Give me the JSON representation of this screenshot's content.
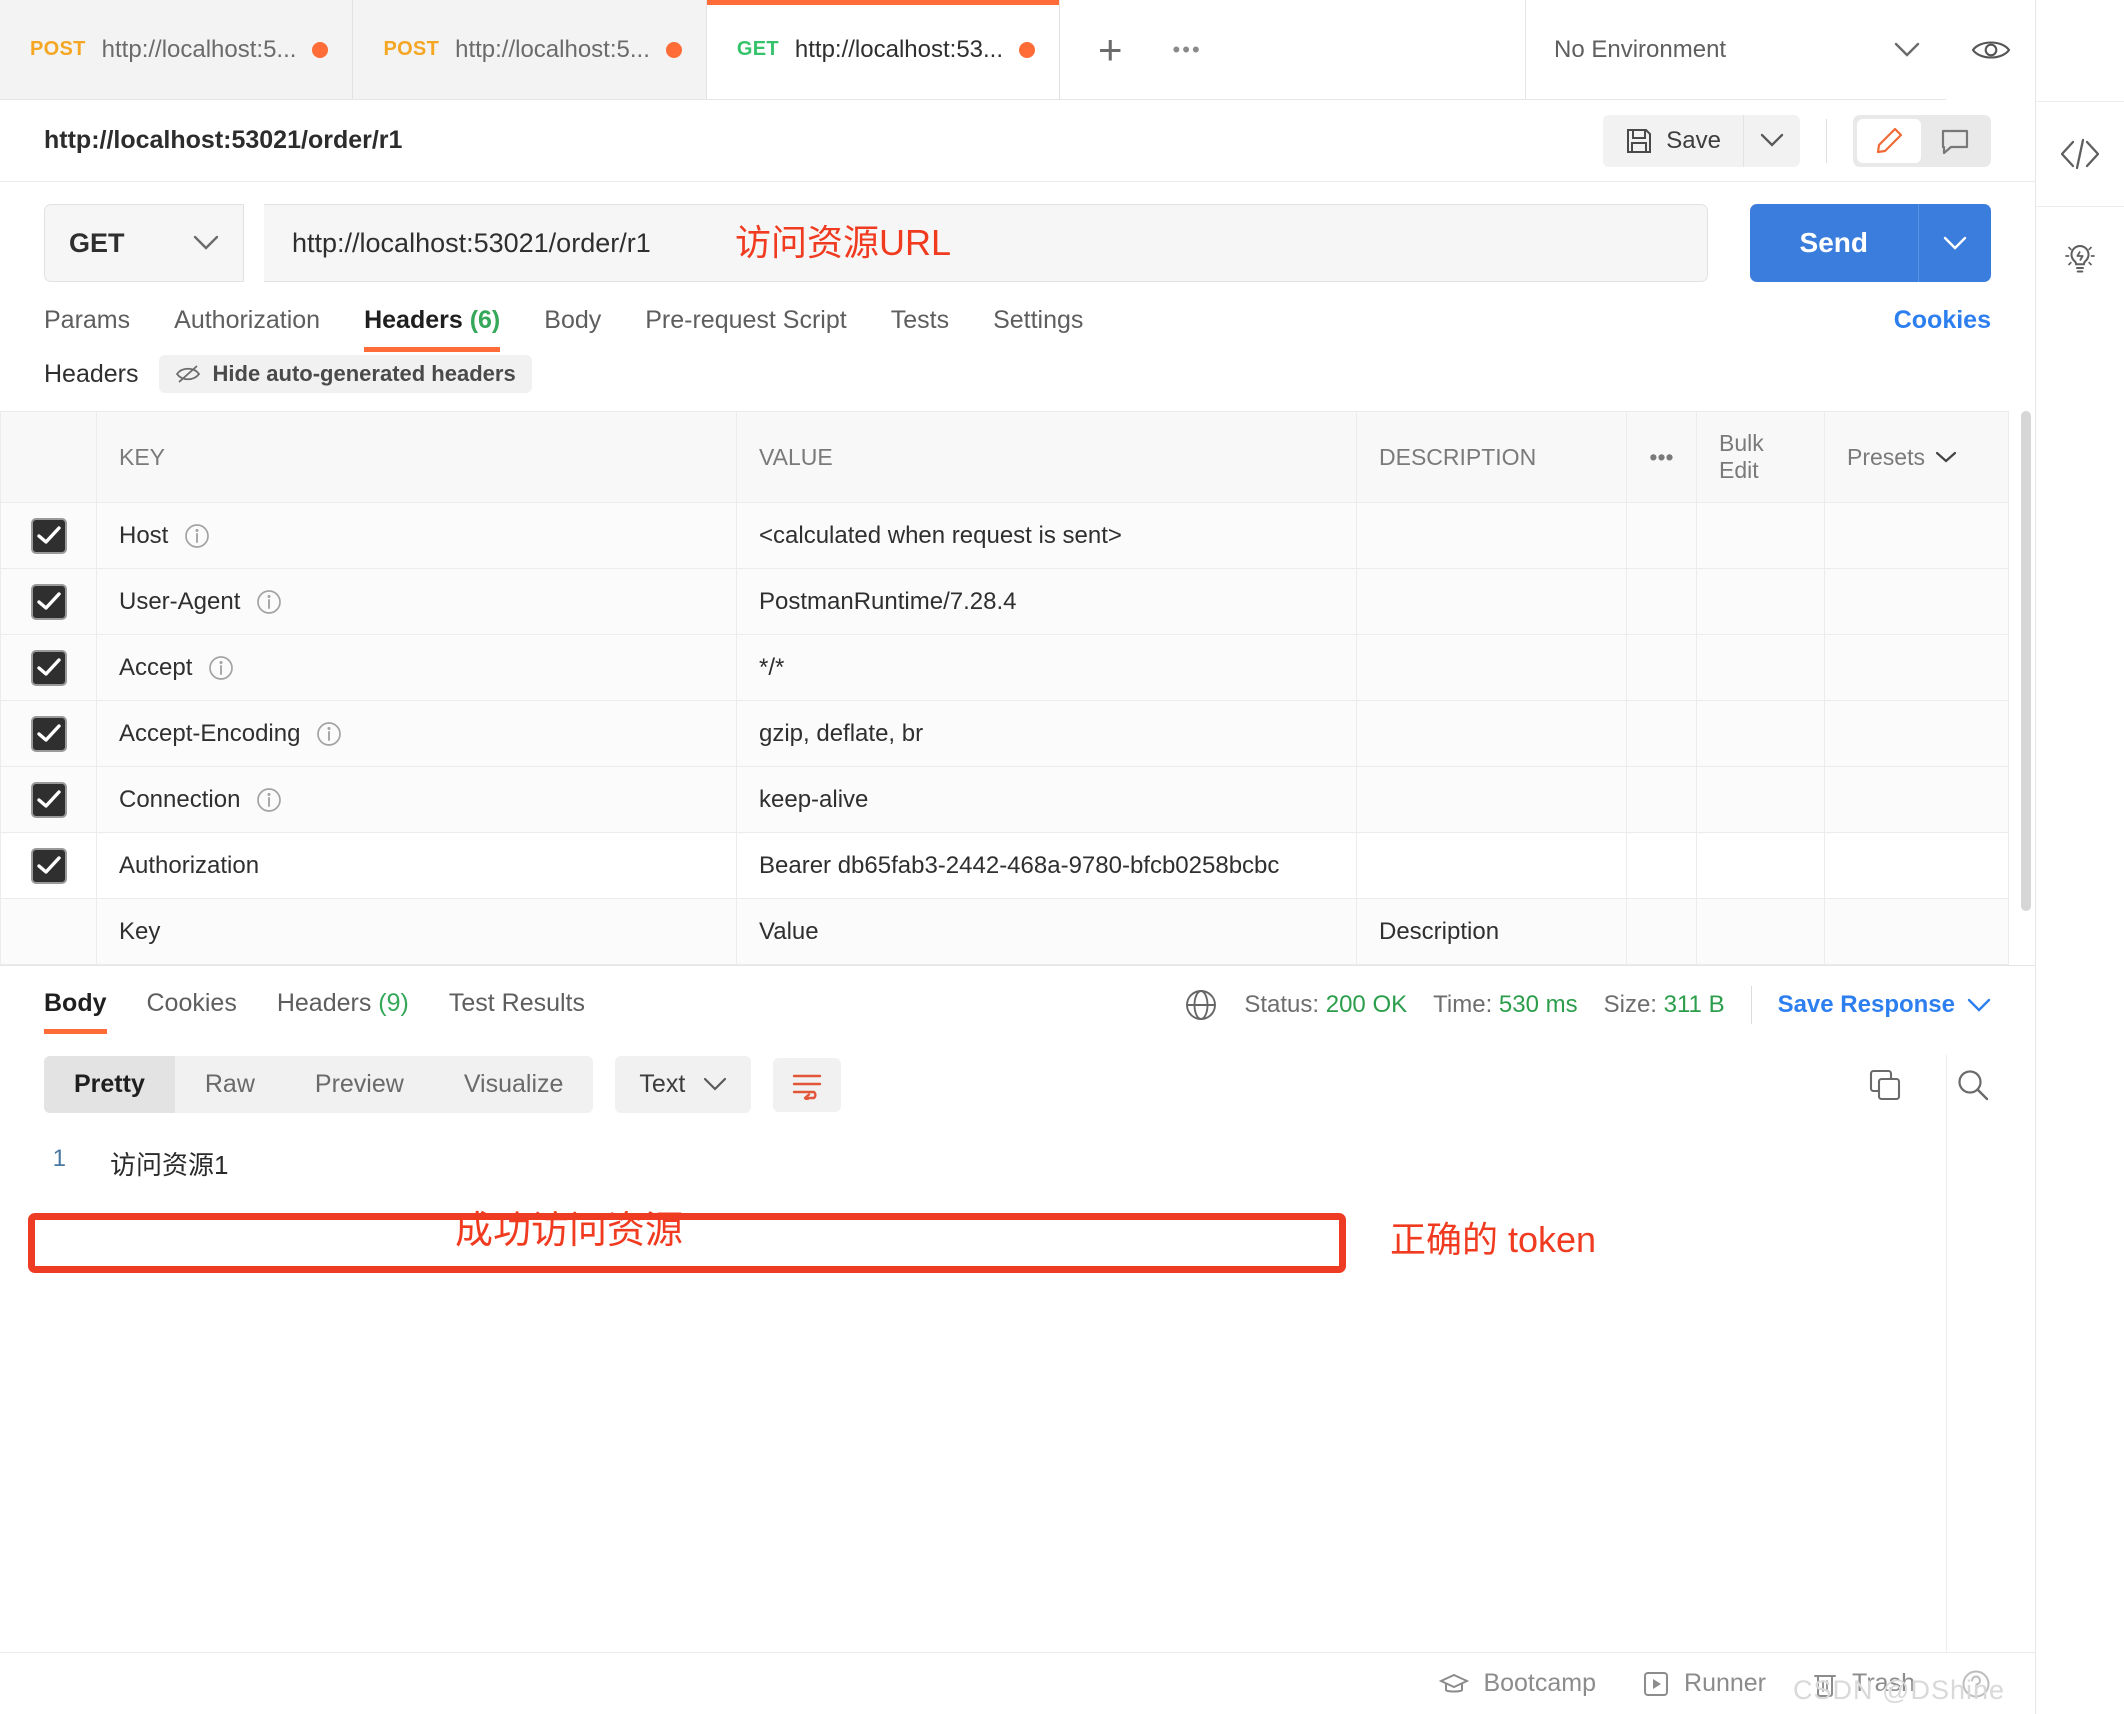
{
  "tabbar": {
    "tabs": [
      {
        "method": "POST",
        "url": "http://localhost:5...",
        "active": false
      },
      {
        "method": "POST",
        "url": "http://localhost:5...",
        "active": false
      },
      {
        "method": "GET",
        "url": "http://localhost:53...",
        "active": true
      }
    ],
    "new_tab_label": "+",
    "more_label": "•••",
    "environment": "No Environment"
  },
  "title": {
    "request_name": "http://localhost:53021/order/r1",
    "save_label": "Save"
  },
  "urlbar": {
    "method": "GET",
    "url": "http://localhost:53021/order/r1",
    "send_label": "Send",
    "annotation": "访问资源URL"
  },
  "request_tabs": {
    "items": [
      {
        "label": "Params",
        "count": "",
        "active": false
      },
      {
        "label": "Authorization",
        "count": "",
        "active": false
      },
      {
        "label": "Headers",
        "count": "(6)",
        "active": true
      },
      {
        "label": "Body",
        "count": "",
        "active": false
      },
      {
        "label": "Pre-request Script",
        "count": "",
        "active": false
      },
      {
        "label": "Tests",
        "count": "",
        "active": false
      },
      {
        "label": "Settings",
        "count": "",
        "active": false
      }
    ],
    "cookies_label": "Cookies"
  },
  "headers_section": {
    "title": "Headers",
    "hide_auto_label": "Hide auto-generated headers",
    "columns": {
      "key": "KEY",
      "value": "VALUE",
      "description": "DESCRIPTION",
      "more": "•••",
      "bulk_edit": "Bulk Edit",
      "presets": "Presets"
    },
    "rows": [
      {
        "checked": true,
        "key": "Host",
        "has_info": true,
        "value": "<calculated when request is sent>",
        "description": ""
      },
      {
        "checked": true,
        "key": "User-Agent",
        "has_info": true,
        "value": "PostmanRuntime/7.28.4",
        "description": ""
      },
      {
        "checked": true,
        "key": "Accept",
        "has_info": true,
        "value": "*/*",
        "description": ""
      },
      {
        "checked": true,
        "key": "Accept-Encoding",
        "has_info": true,
        "value": "gzip, deflate, br",
        "description": ""
      },
      {
        "checked": true,
        "key": "Connection",
        "has_info": true,
        "value": "keep-alive",
        "description": ""
      },
      {
        "checked": true,
        "key": "Authorization",
        "has_info": false,
        "value": "Bearer db65fab3-2442-468a-9780-bfcb0258bcbc",
        "description": ""
      }
    ],
    "placeholder_row": {
      "key": "Key",
      "value": "Value",
      "description": "Description"
    },
    "annotation_token": "正确的 token"
  },
  "response": {
    "tabs": [
      {
        "label": "Body",
        "count": "",
        "active": true
      },
      {
        "label": "Cookies",
        "count": "",
        "active": false
      },
      {
        "label": "Headers",
        "count": "(9)",
        "active": false
      },
      {
        "label": "Test Results",
        "count": "",
        "active": false
      }
    ],
    "status_label": "Status:",
    "status_value": "200 OK",
    "time_label": "Time:",
    "time_value": "530 ms",
    "size_label": "Size:",
    "size_value": "311 B",
    "save_response_label": "Save Response",
    "view_modes": [
      {
        "label": "Pretty",
        "active": true
      },
      {
        "label": "Raw",
        "active": false
      },
      {
        "label": "Preview",
        "active": false
      },
      {
        "label": "Visualize",
        "active": false
      }
    ],
    "format": "Text",
    "body_line_number": "1",
    "body_text": "访问资源1",
    "annotation_body": "成功访问资源"
  },
  "bottombar": {
    "items": [
      {
        "label": "Bootcamp",
        "icon": "graduation-cap-icon"
      },
      {
        "label": "Runner",
        "icon": "play-icon"
      },
      {
        "label": "Trash",
        "icon": "trash-icon"
      }
    ],
    "watermark": "CSDN @DShine"
  },
  "colors": {
    "accent_orange": "#ff6c37",
    "send_blue": "#3b7ddd",
    "link_blue": "#2d7ff0",
    "success_green": "#2c9e4b",
    "annotation_red": "#f03b20",
    "method_get": "#35c46b",
    "method_post": "#f5a623"
  }
}
